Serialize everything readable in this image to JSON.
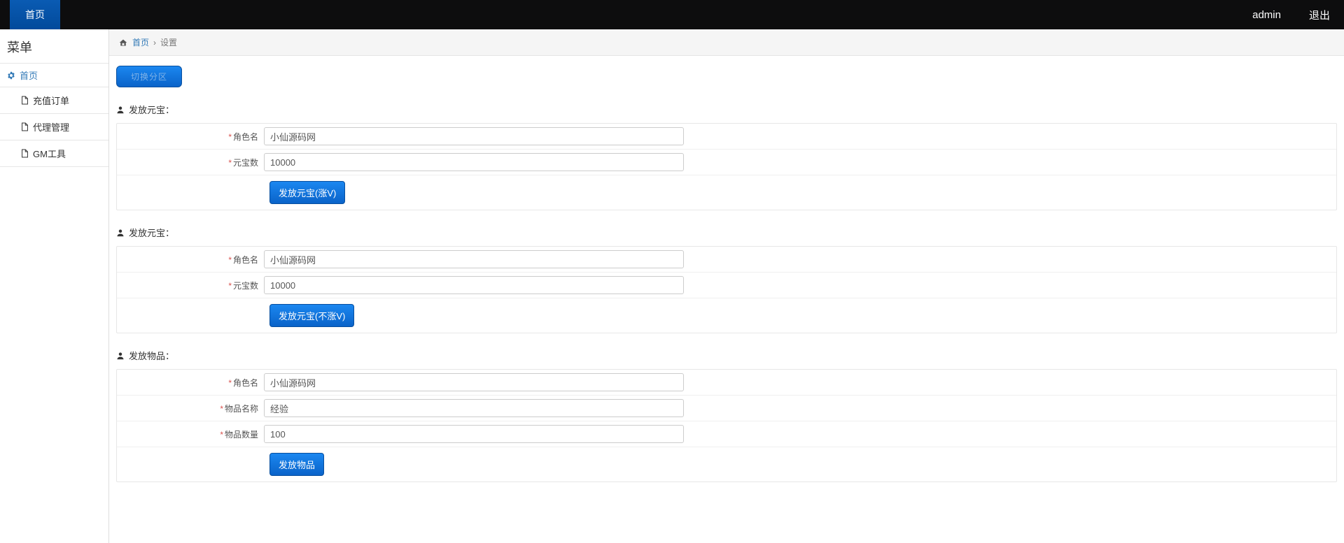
{
  "topbar": {
    "brand": "首页",
    "user": "admin",
    "logout": "退出"
  },
  "sidebar": {
    "title": "菜单",
    "group": "首页",
    "items": [
      "充值订单",
      "代理管理",
      "GM工具"
    ]
  },
  "breadcrumb": {
    "home": "首页",
    "sep": "›",
    "current": "设置"
  },
  "pill": "切换分区",
  "sections": [
    {
      "title": "发放元宝：",
      "fields": [
        {
          "label": "角色名",
          "value": "小仙源码网"
        },
        {
          "label": "元宝数",
          "value": "10000"
        }
      ],
      "button": "发放元宝(涨V)"
    },
    {
      "title": "发放元宝：",
      "fields": [
        {
          "label": "角色名",
          "value": "小仙源码网"
        },
        {
          "label": "元宝数",
          "value": "10000"
        }
      ],
      "button": "发放元宝(不涨V)"
    },
    {
      "title": "发放物品：",
      "fields": [
        {
          "label": "角色名",
          "value": "小仙源码网"
        },
        {
          "label": "物品名称",
          "value": "经验"
        },
        {
          "label": "物品数量",
          "value": "100"
        }
      ],
      "button": "发放物品"
    }
  ]
}
